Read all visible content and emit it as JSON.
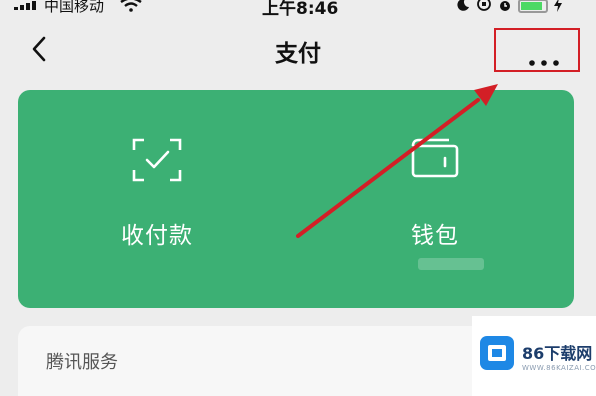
{
  "status_bar": {
    "carrier": "中国移动",
    "time": "上午8:46",
    "battery_level": 0.8,
    "icons": [
      "signal-icon",
      "wifi-icon",
      "moon-icon",
      "orientation-lock-icon",
      "alarm-icon",
      "battery-icon",
      "charging-icon"
    ]
  },
  "nav": {
    "title": "支付",
    "back_icon": "chevron-left-icon",
    "more_icon": "more-dots-icon"
  },
  "card": {
    "color": "#3cb074",
    "receive": {
      "label": "收付款",
      "icon": "scan-check-icon"
    },
    "wallet": {
      "label": "钱包",
      "icon": "wallet-icon"
    }
  },
  "services": {
    "title": "腾讯服务"
  },
  "annotation": {
    "color": "#d31f26"
  },
  "watermark": {
    "brand": "86下载网",
    "url": "WWW.86KAIZAI.COM"
  }
}
